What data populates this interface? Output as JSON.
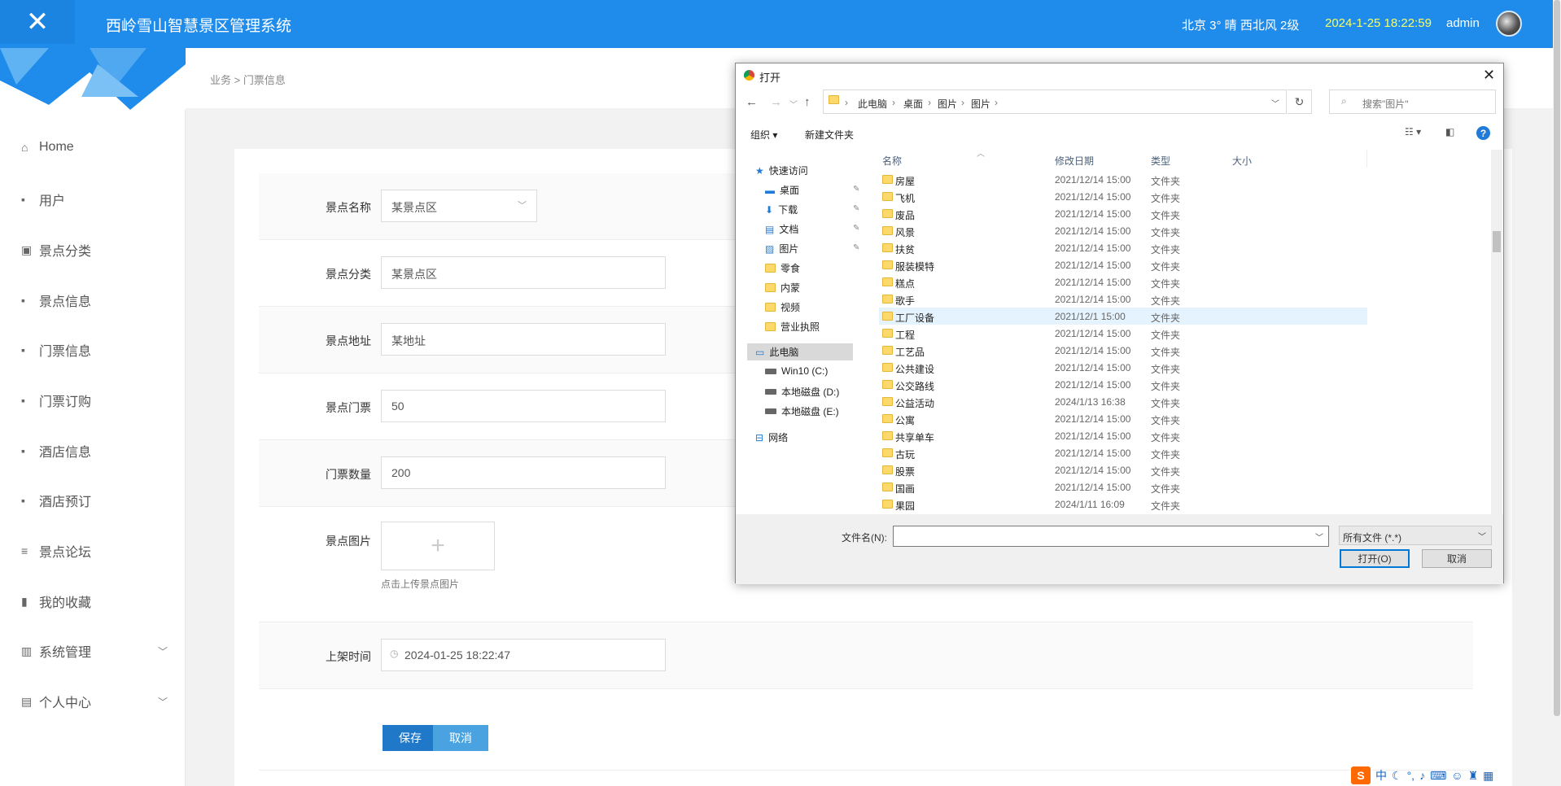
{
  "header": {
    "close_icon": "close-icon",
    "title": "西岭雪山智慧景区管理系统",
    "weather": "北京  3°  晴  西北风  2级",
    "datetime": "2024-1-25 18:22:59",
    "username": "admin",
    "accent": "#1f8ceb"
  },
  "sidebar": {
    "items": [
      {
        "icon": "home-icon",
        "glyph": "⌂",
        "label": "Home"
      },
      {
        "icon": "grid-icon",
        "glyph": "▪",
        "label": "用户"
      },
      {
        "icon": "clipboard-icon",
        "glyph": "▣",
        "label": "景点分类"
      },
      {
        "icon": "grid-icon",
        "glyph": "▪",
        "label": "景点信息"
      },
      {
        "icon": "grid-icon",
        "glyph": "▪",
        "label": "门票信息"
      },
      {
        "icon": "grid-icon",
        "glyph": "▪",
        "label": "门票订购"
      },
      {
        "icon": "grid-icon",
        "glyph": "▪",
        "label": "酒店信息"
      },
      {
        "icon": "grid-icon",
        "glyph": "▪",
        "label": "酒店预订"
      },
      {
        "icon": "list-icon",
        "glyph": "≡",
        "label": "景点论坛"
      },
      {
        "icon": "bar-chart-icon",
        "glyph": "▮",
        "label": "我的收藏"
      },
      {
        "icon": "book-icon",
        "glyph": "▥",
        "label": "系统管理"
      },
      {
        "icon": "profile-icon",
        "glyph": "▤",
        "label": "个人中心"
      }
    ]
  },
  "breadcrumb": "业务 > 门票信息",
  "form": {
    "spot_name_label": "景点名称",
    "spot_name_value": "某景点区",
    "category_label": "景点分类",
    "category_value": "某景点区",
    "address_label": "景点地址",
    "address_value": "某地址",
    "ticket_label": "景点门票",
    "ticket_value": "50",
    "quantity_label": "门票数量",
    "quantity_value": "200",
    "image_label": "景点图片",
    "upload_plus": "+",
    "upload_hint": "点击上传景点图片",
    "time_label": "上架时间",
    "time_value": "2024-01-25 18:22:47",
    "save": "保存",
    "cancel": "取消",
    "save_color": "#1f78c8",
    "cancel_color": "#4aa3e0"
  },
  "dialog": {
    "title": "打开",
    "close": "✕",
    "path": [
      "此电脑",
      "桌面",
      "图片",
      "图片"
    ],
    "search_placeholder": "搜索\"图片\"",
    "organize": "组织 ▾",
    "new_folder": "新建文件夹",
    "help": "?",
    "tree": [
      {
        "label": "快速访问",
        "kind": "star",
        "pin": false
      },
      {
        "label": "桌面",
        "kind": "desktop",
        "pin": true
      },
      {
        "label": "下载",
        "kind": "download",
        "pin": true
      },
      {
        "label": "文档",
        "kind": "doc",
        "pin": true
      },
      {
        "label": "图片",
        "kind": "pic",
        "pin": true
      },
      {
        "label": "零食",
        "kind": "folder",
        "pin": false
      },
      {
        "label": "内蒙",
        "kind": "folder",
        "pin": false
      },
      {
        "label": "视频",
        "kind": "folder",
        "pin": false
      },
      {
        "label": "营业执照",
        "kind": "folder",
        "pin": false
      },
      {
        "label": "此电脑",
        "kind": "pc",
        "pin": false
      },
      {
        "label": "Win10 (C:)",
        "kind": "drive",
        "pin": false
      },
      {
        "label": "本地磁盘 (D:)",
        "kind": "drive",
        "pin": false
      },
      {
        "label": "本地磁盘 (E:)",
        "kind": "drive",
        "pin": false
      },
      {
        "label": "网络",
        "kind": "net",
        "pin": false
      }
    ],
    "columns": [
      "名称",
      "修改日期",
      "类型",
      "大小"
    ],
    "files": [
      {
        "name": "房屋",
        "date": "2021/12/14 15:00",
        "type": "文件夹"
      },
      {
        "name": "飞机",
        "date": "2021/12/14 15:00",
        "type": "文件夹"
      },
      {
        "name": "废品",
        "date": "2021/12/14 15:00",
        "type": "文件夹"
      },
      {
        "name": "风景",
        "date": "2021/12/14 15:00",
        "type": "文件夹"
      },
      {
        "name": "扶贫",
        "date": "2021/12/14 15:00",
        "type": "文件夹"
      },
      {
        "name": "服装模特",
        "date": "2021/12/14 15:00",
        "type": "文件夹"
      },
      {
        "name": "糕点",
        "date": "2021/12/14 15:00",
        "type": "文件夹"
      },
      {
        "name": "歌手",
        "date": "2021/12/14 15:00",
        "type": "文件夹"
      },
      {
        "name": "工厂设备",
        "date": "2021/12/1 15:00",
        "type": "文件夹"
      },
      {
        "name": "工程",
        "date": "2021/12/14 15:00",
        "type": "文件夹"
      },
      {
        "name": "工艺品",
        "date": "2021/12/14 15:00",
        "type": "文件夹"
      },
      {
        "name": "公共建设",
        "date": "2021/12/14 15:00",
        "type": "文件夹"
      },
      {
        "name": "公交路线",
        "date": "2021/12/14 15:00",
        "type": "文件夹"
      },
      {
        "name": "公益活动",
        "date": "2024/1/13 16:38",
        "type": "文件夹"
      },
      {
        "name": "公寓",
        "date": "2021/12/14 15:00",
        "type": "文件夹"
      },
      {
        "name": "共享单车",
        "date": "2021/12/14 15:00",
        "type": "文件夹"
      },
      {
        "name": "古玩",
        "date": "2021/12/14 15:00",
        "type": "文件夹"
      },
      {
        "name": "股票",
        "date": "2021/12/14 15:00",
        "type": "文件夹"
      },
      {
        "name": "国画",
        "date": "2021/12/14 15:00",
        "type": "文件夹"
      },
      {
        "name": "果园",
        "date": "2024/1/11 16:09",
        "type": "文件夹"
      }
    ],
    "filename_label": "文件名(N):",
    "filename_value": "",
    "filetype": "所有文件 (*.*)",
    "open": "打开(O)",
    "cancel": "取消"
  },
  "ime": {
    "logo": "S",
    "lang": "中"
  }
}
